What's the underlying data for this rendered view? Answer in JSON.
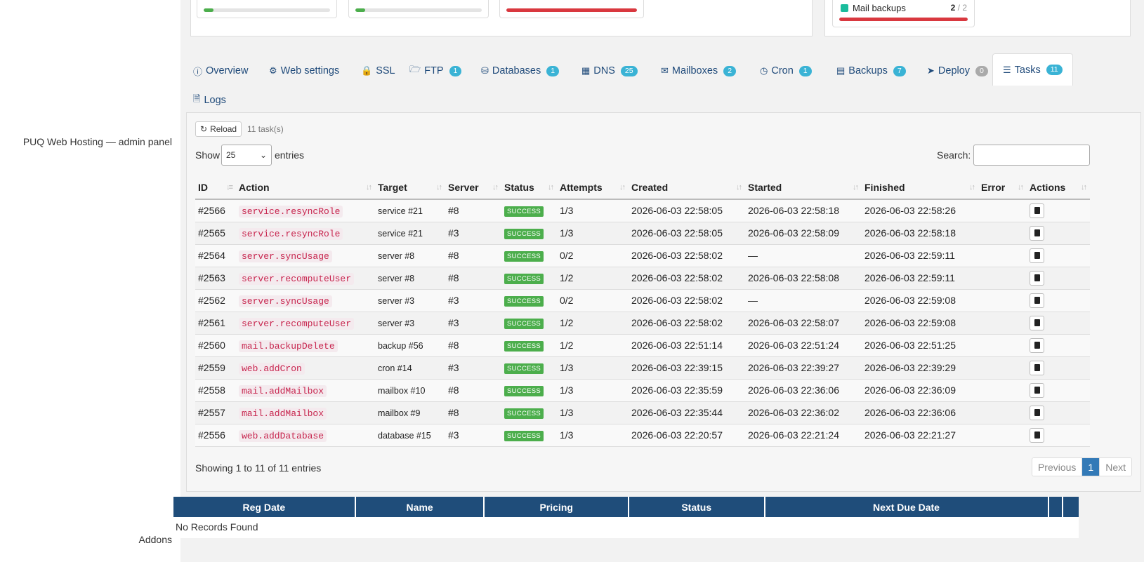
{
  "left": {
    "panel_label": "PUQ Web Hosting — admin panel",
    "addons_label": "Addons"
  },
  "quotas": {
    "mail_backups": {
      "label": "Mail backups",
      "used": "2",
      "total": "/ 2",
      "fill": 1.0,
      "color": "#d9383f"
    },
    "q1": {
      "fill": 0.08,
      "color": "#4cae4c"
    },
    "q2": {
      "fill": 0.08,
      "color": "#4cae4c"
    },
    "q3": {
      "fill": 1.0,
      "color": "#d9383f"
    }
  },
  "tabs": [
    {
      "label": "Overview",
      "icon": "info-icon"
    },
    {
      "label": "Web settings",
      "icon": "gear-icon"
    },
    {
      "label": "SSL",
      "icon": "lock-icon"
    },
    {
      "label": "FTP",
      "icon": "folder-icon",
      "badge": "1"
    },
    {
      "label": "Databases",
      "icon": "database-icon",
      "badge": "1"
    },
    {
      "label": "DNS",
      "icon": "network-icon",
      "badge": "25"
    },
    {
      "label": "Mailboxes",
      "icon": "envelope-icon",
      "badge": "2"
    },
    {
      "label": "Cron",
      "icon": "clock-icon",
      "badge": "1"
    },
    {
      "label": "Backups",
      "icon": "archive-icon",
      "badge": "7"
    },
    {
      "label": "Deploy",
      "icon": "rocket-icon",
      "badge": "0"
    },
    {
      "label": "Tasks",
      "icon": "list-icon",
      "badge": "11"
    },
    {
      "label": "Logs",
      "icon": "file-icon"
    }
  ],
  "tasks": {
    "reload_label": "Reload",
    "count_text": "11 task(s)",
    "show_label": "Show",
    "entries_value": "25",
    "entries_label": "entries",
    "search_label": "Search:",
    "columns": [
      "ID",
      "Action",
      "Target",
      "Server",
      "Status",
      "Attempts",
      "Created",
      "Started",
      "Finished",
      "Error",
      "Actions"
    ],
    "rows": [
      {
        "id": "#2566",
        "action": "service.resyncRole",
        "target": "service #21",
        "server": "#8",
        "status": "SUCCESS",
        "attempts": "1/3",
        "created": "2026-06-03 22:58:05",
        "started": "2026-06-03 22:58:18",
        "finished": "2026-06-03 22:58:26",
        "error": ""
      },
      {
        "id": "#2565",
        "action": "service.resyncRole",
        "target": "service #21",
        "server": "#3",
        "status": "SUCCESS",
        "attempts": "1/3",
        "created": "2026-06-03 22:58:05",
        "started": "2026-06-03 22:58:09",
        "finished": "2026-06-03 22:58:18",
        "error": ""
      },
      {
        "id": "#2564",
        "action": "server.syncUsage",
        "target": "server #8",
        "server": "#8",
        "status": "SUCCESS",
        "attempts": "0/2",
        "created": "2026-06-03 22:58:02",
        "started": "—",
        "finished": "2026-06-03 22:59:11",
        "error": ""
      },
      {
        "id": "#2563",
        "action": "server.recomputeUser",
        "target": "server #8",
        "server": "#8",
        "status": "SUCCESS",
        "attempts": "1/2",
        "created": "2026-06-03 22:58:02",
        "started": "2026-06-03 22:58:08",
        "finished": "2026-06-03 22:59:11",
        "error": ""
      },
      {
        "id": "#2562",
        "action": "server.syncUsage",
        "target": "server #3",
        "server": "#3",
        "status": "SUCCESS",
        "attempts": "0/2",
        "created": "2026-06-03 22:58:02",
        "started": "—",
        "finished": "2026-06-03 22:59:08",
        "error": ""
      },
      {
        "id": "#2561",
        "action": "server.recomputeUser",
        "target": "server #3",
        "server": "#3",
        "status": "SUCCESS",
        "attempts": "1/2",
        "created": "2026-06-03 22:58:02",
        "started": "2026-06-03 22:58:07",
        "finished": "2026-06-03 22:59:08",
        "error": ""
      },
      {
        "id": "#2560",
        "action": "mail.backupDelete",
        "target": "backup #56",
        "server": "#8",
        "status": "SUCCESS",
        "attempts": "1/2",
        "created": "2026-06-03 22:51:14",
        "started": "2026-06-03 22:51:24",
        "finished": "2026-06-03 22:51:25",
        "error": ""
      },
      {
        "id": "#2559",
        "action": "web.addCron",
        "target": "cron #14",
        "server": "#3",
        "status": "SUCCESS",
        "attempts": "1/3",
        "created": "2026-06-03 22:39:15",
        "started": "2026-06-03 22:39:27",
        "finished": "2026-06-03 22:39:29",
        "error": ""
      },
      {
        "id": "#2558",
        "action": "mail.addMailbox",
        "target": "mailbox #10",
        "server": "#8",
        "status": "SUCCESS",
        "attempts": "1/3",
        "created": "2026-06-03 22:35:59",
        "started": "2026-06-03 22:36:06",
        "finished": "2026-06-03 22:36:09",
        "error": ""
      },
      {
        "id": "#2557",
        "action": "mail.addMailbox",
        "target": "mailbox #9",
        "server": "#8",
        "status": "SUCCESS",
        "attempts": "1/3",
        "created": "2026-06-03 22:35:44",
        "started": "2026-06-03 22:36:02",
        "finished": "2026-06-03 22:36:06",
        "error": ""
      },
      {
        "id": "#2556",
        "action": "web.addDatabase",
        "target": "database #15",
        "server": "#3",
        "status": "SUCCESS",
        "attempts": "1/3",
        "created": "2026-06-03 22:20:57",
        "started": "2026-06-03 22:21:24",
        "finished": "2026-06-03 22:21:27",
        "error": ""
      }
    ],
    "showing_text": "Showing 1 to 11 of 11 entries",
    "pager": {
      "previous": "Previous",
      "current": "1",
      "next": "Next"
    }
  },
  "addons": {
    "columns": [
      "Reg Date",
      "Name",
      "Pricing",
      "Status",
      "Next Due Date"
    ],
    "empty_text": "No Records Found"
  }
}
